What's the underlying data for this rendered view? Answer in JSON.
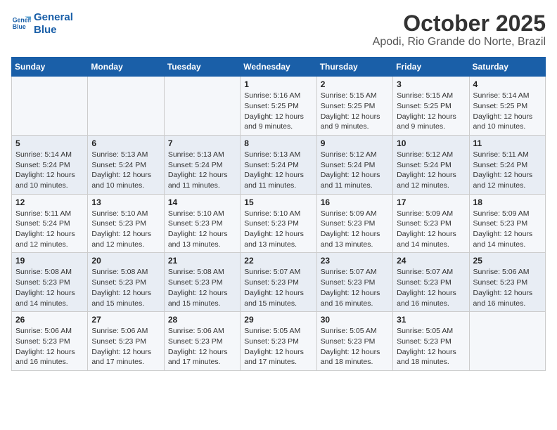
{
  "logo": {
    "line1": "General",
    "line2": "Blue"
  },
  "title": "October 2025",
  "subtitle": "Apodi, Rio Grande do Norte, Brazil",
  "days_of_week": [
    "Sunday",
    "Monday",
    "Tuesday",
    "Wednesday",
    "Thursday",
    "Friday",
    "Saturday"
  ],
  "weeks": [
    [
      {
        "day": "",
        "info": ""
      },
      {
        "day": "",
        "info": ""
      },
      {
        "day": "",
        "info": ""
      },
      {
        "day": "1",
        "sunrise": "5:16 AM",
        "sunset": "5:25 PM",
        "daylight": "12 hours and 9 minutes."
      },
      {
        "day": "2",
        "sunrise": "5:15 AM",
        "sunset": "5:25 PM",
        "daylight": "12 hours and 9 minutes."
      },
      {
        "day": "3",
        "sunrise": "5:15 AM",
        "sunset": "5:25 PM",
        "daylight": "12 hours and 9 minutes."
      },
      {
        "day": "4",
        "sunrise": "5:14 AM",
        "sunset": "5:25 PM",
        "daylight": "12 hours and 10 minutes."
      }
    ],
    [
      {
        "day": "5",
        "sunrise": "5:14 AM",
        "sunset": "5:24 PM",
        "daylight": "12 hours and 10 minutes."
      },
      {
        "day": "6",
        "sunrise": "5:13 AM",
        "sunset": "5:24 PM",
        "daylight": "12 hours and 10 minutes."
      },
      {
        "day": "7",
        "sunrise": "5:13 AM",
        "sunset": "5:24 PM",
        "daylight": "12 hours and 11 minutes."
      },
      {
        "day": "8",
        "sunrise": "5:13 AM",
        "sunset": "5:24 PM",
        "daylight": "12 hours and 11 minutes."
      },
      {
        "day": "9",
        "sunrise": "5:12 AM",
        "sunset": "5:24 PM",
        "daylight": "12 hours and 11 minutes."
      },
      {
        "day": "10",
        "sunrise": "5:12 AM",
        "sunset": "5:24 PM",
        "daylight": "12 hours and 12 minutes."
      },
      {
        "day": "11",
        "sunrise": "5:11 AM",
        "sunset": "5:24 PM",
        "daylight": "12 hours and 12 minutes."
      }
    ],
    [
      {
        "day": "12",
        "sunrise": "5:11 AM",
        "sunset": "5:24 PM",
        "daylight": "12 hours and 12 minutes."
      },
      {
        "day": "13",
        "sunrise": "5:10 AM",
        "sunset": "5:23 PM",
        "daylight": "12 hours and 12 minutes."
      },
      {
        "day": "14",
        "sunrise": "5:10 AM",
        "sunset": "5:23 PM",
        "daylight": "12 hours and 13 minutes."
      },
      {
        "day": "15",
        "sunrise": "5:10 AM",
        "sunset": "5:23 PM",
        "daylight": "12 hours and 13 minutes."
      },
      {
        "day": "16",
        "sunrise": "5:09 AM",
        "sunset": "5:23 PM",
        "daylight": "12 hours and 13 minutes."
      },
      {
        "day": "17",
        "sunrise": "5:09 AM",
        "sunset": "5:23 PM",
        "daylight": "12 hours and 14 minutes."
      },
      {
        "day": "18",
        "sunrise": "5:09 AM",
        "sunset": "5:23 PM",
        "daylight": "12 hours and 14 minutes."
      }
    ],
    [
      {
        "day": "19",
        "sunrise": "5:08 AM",
        "sunset": "5:23 PM",
        "daylight": "12 hours and 14 minutes."
      },
      {
        "day": "20",
        "sunrise": "5:08 AM",
        "sunset": "5:23 PM",
        "daylight": "12 hours and 15 minutes."
      },
      {
        "day": "21",
        "sunrise": "5:08 AM",
        "sunset": "5:23 PM",
        "daylight": "12 hours and 15 minutes."
      },
      {
        "day": "22",
        "sunrise": "5:07 AM",
        "sunset": "5:23 PM",
        "daylight": "12 hours and 15 minutes."
      },
      {
        "day": "23",
        "sunrise": "5:07 AM",
        "sunset": "5:23 PM",
        "daylight": "12 hours and 16 minutes."
      },
      {
        "day": "24",
        "sunrise": "5:07 AM",
        "sunset": "5:23 PM",
        "daylight": "12 hours and 16 minutes."
      },
      {
        "day": "25",
        "sunrise": "5:06 AM",
        "sunset": "5:23 PM",
        "daylight": "12 hours and 16 minutes."
      }
    ],
    [
      {
        "day": "26",
        "sunrise": "5:06 AM",
        "sunset": "5:23 PM",
        "daylight": "12 hours and 16 minutes."
      },
      {
        "day": "27",
        "sunrise": "5:06 AM",
        "sunset": "5:23 PM",
        "daylight": "12 hours and 17 minutes."
      },
      {
        "day": "28",
        "sunrise": "5:06 AM",
        "sunset": "5:23 PM",
        "daylight": "12 hours and 17 minutes."
      },
      {
        "day": "29",
        "sunrise": "5:05 AM",
        "sunset": "5:23 PM",
        "daylight": "12 hours and 17 minutes."
      },
      {
        "day": "30",
        "sunrise": "5:05 AM",
        "sunset": "5:23 PM",
        "daylight": "12 hours and 18 minutes."
      },
      {
        "day": "31",
        "sunrise": "5:05 AM",
        "sunset": "5:23 PM",
        "daylight": "12 hours and 18 minutes."
      },
      {
        "day": "",
        "info": ""
      }
    ]
  ]
}
